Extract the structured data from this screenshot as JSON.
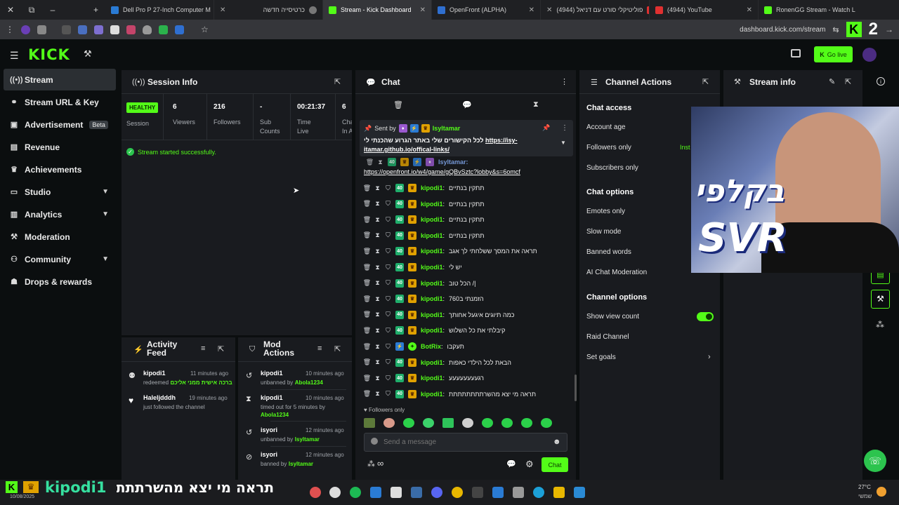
{
  "browser": {
    "tabs": [
      {
        "title": "Dell Pro P 27-Inch Computer M",
        "fav": "#2a7bd4"
      },
      {
        "title": "כרטיסייה חדשה",
        "fav": "#888888"
      },
      {
        "title": "Stream - Kick Dashboard",
        "fav": "#53fc18"
      },
      {
        "title": "OpenFront (ALPHA)",
        "fav": "#2f6fd0"
      },
      {
        "title": "פוליטיקלי סורט עם דניאל (4944)",
        "fav": "#e03030"
      },
      {
        "title": "(4944) YouTube",
        "fav": "#e03030"
      },
      {
        "title": "RonenGG Stream - Watch L",
        "fav": "#53fc18"
      }
    ],
    "url": "dashboard.kick.com/stream",
    "big_number": "2",
    "big_k": "K"
  },
  "header": {
    "logo": "KICK",
    "go_live": "Go live"
  },
  "sidebar": {
    "items": [
      {
        "label": "Stream",
        "icon": "(•)"
      },
      {
        "label": "Stream URL & Key",
        "icon": "🔗"
      },
      {
        "label": "Advertisement",
        "icon": "▣",
        "badge": "Beta"
      },
      {
        "label": "Revenue",
        "icon": "▤"
      },
      {
        "label": "Achievements",
        "icon": "🏆"
      },
      {
        "label": "Studio",
        "icon": "▭"
      },
      {
        "label": "Analytics",
        "icon": "▥"
      },
      {
        "label": "Moderation",
        "icon": "🔧"
      },
      {
        "label": "Community",
        "icon": "👥"
      },
      {
        "label": "Drops & rewards",
        "icon": "🎁"
      }
    ]
  },
  "session": {
    "title": "Session Info",
    "healthy": "HEALTHY",
    "session_label": "Session",
    "stats": [
      {
        "value": "6",
        "label": "Viewers"
      },
      {
        "value": "216",
        "label": "Followers"
      },
      {
        "value": "-",
        "label": "Sub Counts"
      },
      {
        "value": "00:21:37",
        "label": "Time Live"
      },
      {
        "value": "6",
        "label": "Cha In A"
      }
    ],
    "status_msg": "Stream started successfully."
  },
  "activity": {
    "title": "Activity Feed",
    "items": [
      {
        "name": "kipodi1",
        "time": "11 minutes ago",
        "sub": "redeemed",
        "green": "ברכה אישית ממני אליכם"
      },
      {
        "name": "Haleljdddh",
        "time": "19 minutes ago",
        "sub": "just followed the channel",
        "green": ""
      }
    ]
  },
  "mod": {
    "title": "Mod Actions",
    "items": [
      {
        "name": "kipodi1",
        "time": "10 minutes ago",
        "sub": "unbanned by",
        "green": "Abola1234",
        "sub2": ""
      },
      {
        "name": "kipodi1",
        "time": "10 minutes ago",
        "sub": "timed out for 5 minutes by",
        "green": "Abola1234",
        "sub2": ""
      },
      {
        "name": "isyori",
        "time": "12 minutes ago",
        "sub": "unbanned by",
        "green": "Isyltamar",
        "sub2": ""
      },
      {
        "name": "isyori",
        "time": "12 minutes ago",
        "sub": "banned by",
        "green": "Isyltamar",
        "sub2": ""
      }
    ]
  },
  "chat": {
    "title": "Chat",
    "pinned_by_label": "Sent by",
    "pinned_user": "Isyltamar",
    "pinned_text": "לכל הקישורים שלי באתר הגרוע שהכנתי לי",
    "pinned_link": "https://isy-itamar.github.io/offical-links/",
    "prev_user": "Isyltamar:",
    "prev_link": "https://openfront.io/w4/game/gQBvSztc?lobby&s=6omcf",
    "messages": [
      {
        "user": "kipodi1",
        "text": "תתקין בנתיים"
      },
      {
        "user": "kipodi1",
        "text": "תתקין בנתיים"
      },
      {
        "user": "kipodi1",
        "text": "תתקין בנתיים"
      },
      {
        "user": "kipodi1",
        "text": "תתקין בנתיים"
      },
      {
        "user": "kipodi1",
        "text": "תראה את המסך ששלחתי לך אגב"
      },
      {
        "user": "kipodi1",
        "text": "יש לי"
      },
      {
        "user": "kipodi1",
        "text": "הכל טוב /|"
      },
      {
        "user": "kipodi1",
        "text": "הזמנתי ב760"
      },
      {
        "user": "kipodi1",
        "text": "כמה תיוגים איגעל אחותך"
      },
      {
        "user": "kipodi1",
        "text": "קיבלתי את כל השלוש"
      },
      {
        "user": "BotRix",
        "text": "תעקבו"
      },
      {
        "user": "kipodi1",
        "text": "הבאת לכל הילדי כאפות"
      },
      {
        "user": "kipodi1",
        "text": "רגעעעעעעעע"
      },
      {
        "user": "kipodi1",
        "text": "תראה מי יצא מהשרתתתתתתתת"
      }
    ],
    "followers_only": "Followers only",
    "placeholder": "Send a message",
    "send": "Chat"
  },
  "channel_actions": {
    "title": "Channel Actions",
    "chat_access": "Chat access",
    "access_items": [
      "Account age",
      "Followers only",
      "Subscribers only"
    ],
    "instant": "Inst",
    "chat_options": "Chat options",
    "option_items": [
      "Emotes only",
      "Slow mode",
      "Banned words",
      "AI Chat Moderation"
    ],
    "channel_options": "Channel options",
    "channel_items": [
      "Show view count",
      "Raid Channel",
      "Set goals"
    ]
  },
  "stream_info": {
    "title": "Stream info",
    "overlay_text": "בקלפי",
    "overlay_brand": "SVR"
  },
  "overlay": {
    "k": "K",
    "name": "kipodi1",
    "message": "תראה מי יצא מהשרתתתתתתתת :"
  },
  "taskbar": {
    "temp": "27°C",
    "weather": "שמשי",
    "date": "10/08/2025"
  }
}
